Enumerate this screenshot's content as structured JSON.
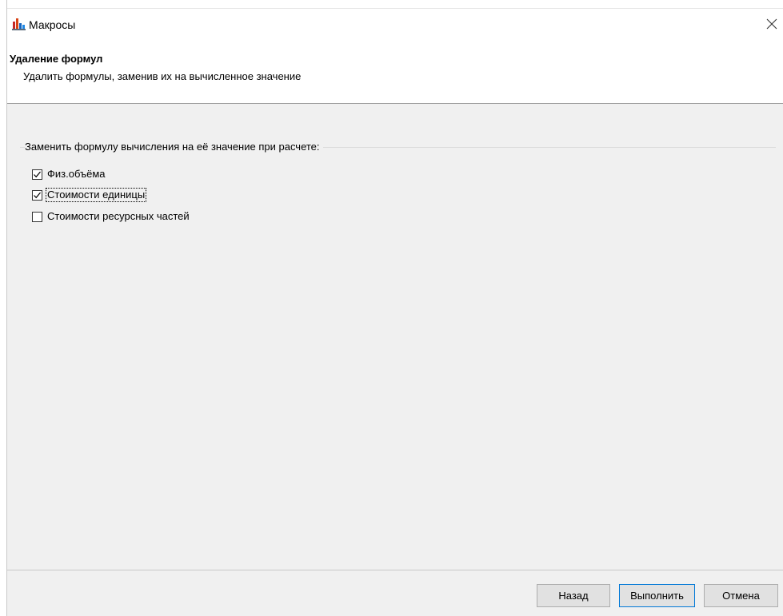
{
  "window": {
    "title": "Макросы",
    "app_icon": "app-chart-icon",
    "close_icon": "close-icon"
  },
  "header": {
    "title": "Удаление формул",
    "subtitle": "Удалить формулы, заменив их на вычисленное значение"
  },
  "options": {
    "group_label": "Заменить формулу вычисления на её значение при расчете:",
    "items": [
      {
        "label": "Физ.объёма",
        "checked": true
      },
      {
        "label": "Стоимости единицы",
        "checked": true
      },
      {
        "label": "Стоимости ресурсных частей",
        "checked": false
      }
    ]
  },
  "footer": {
    "back_label": "Назад",
    "run_label": "Выполнить",
    "cancel_label": "Отмена"
  },
  "colors": {
    "accent": "#0078d7",
    "background": "#f0f0f0"
  }
}
